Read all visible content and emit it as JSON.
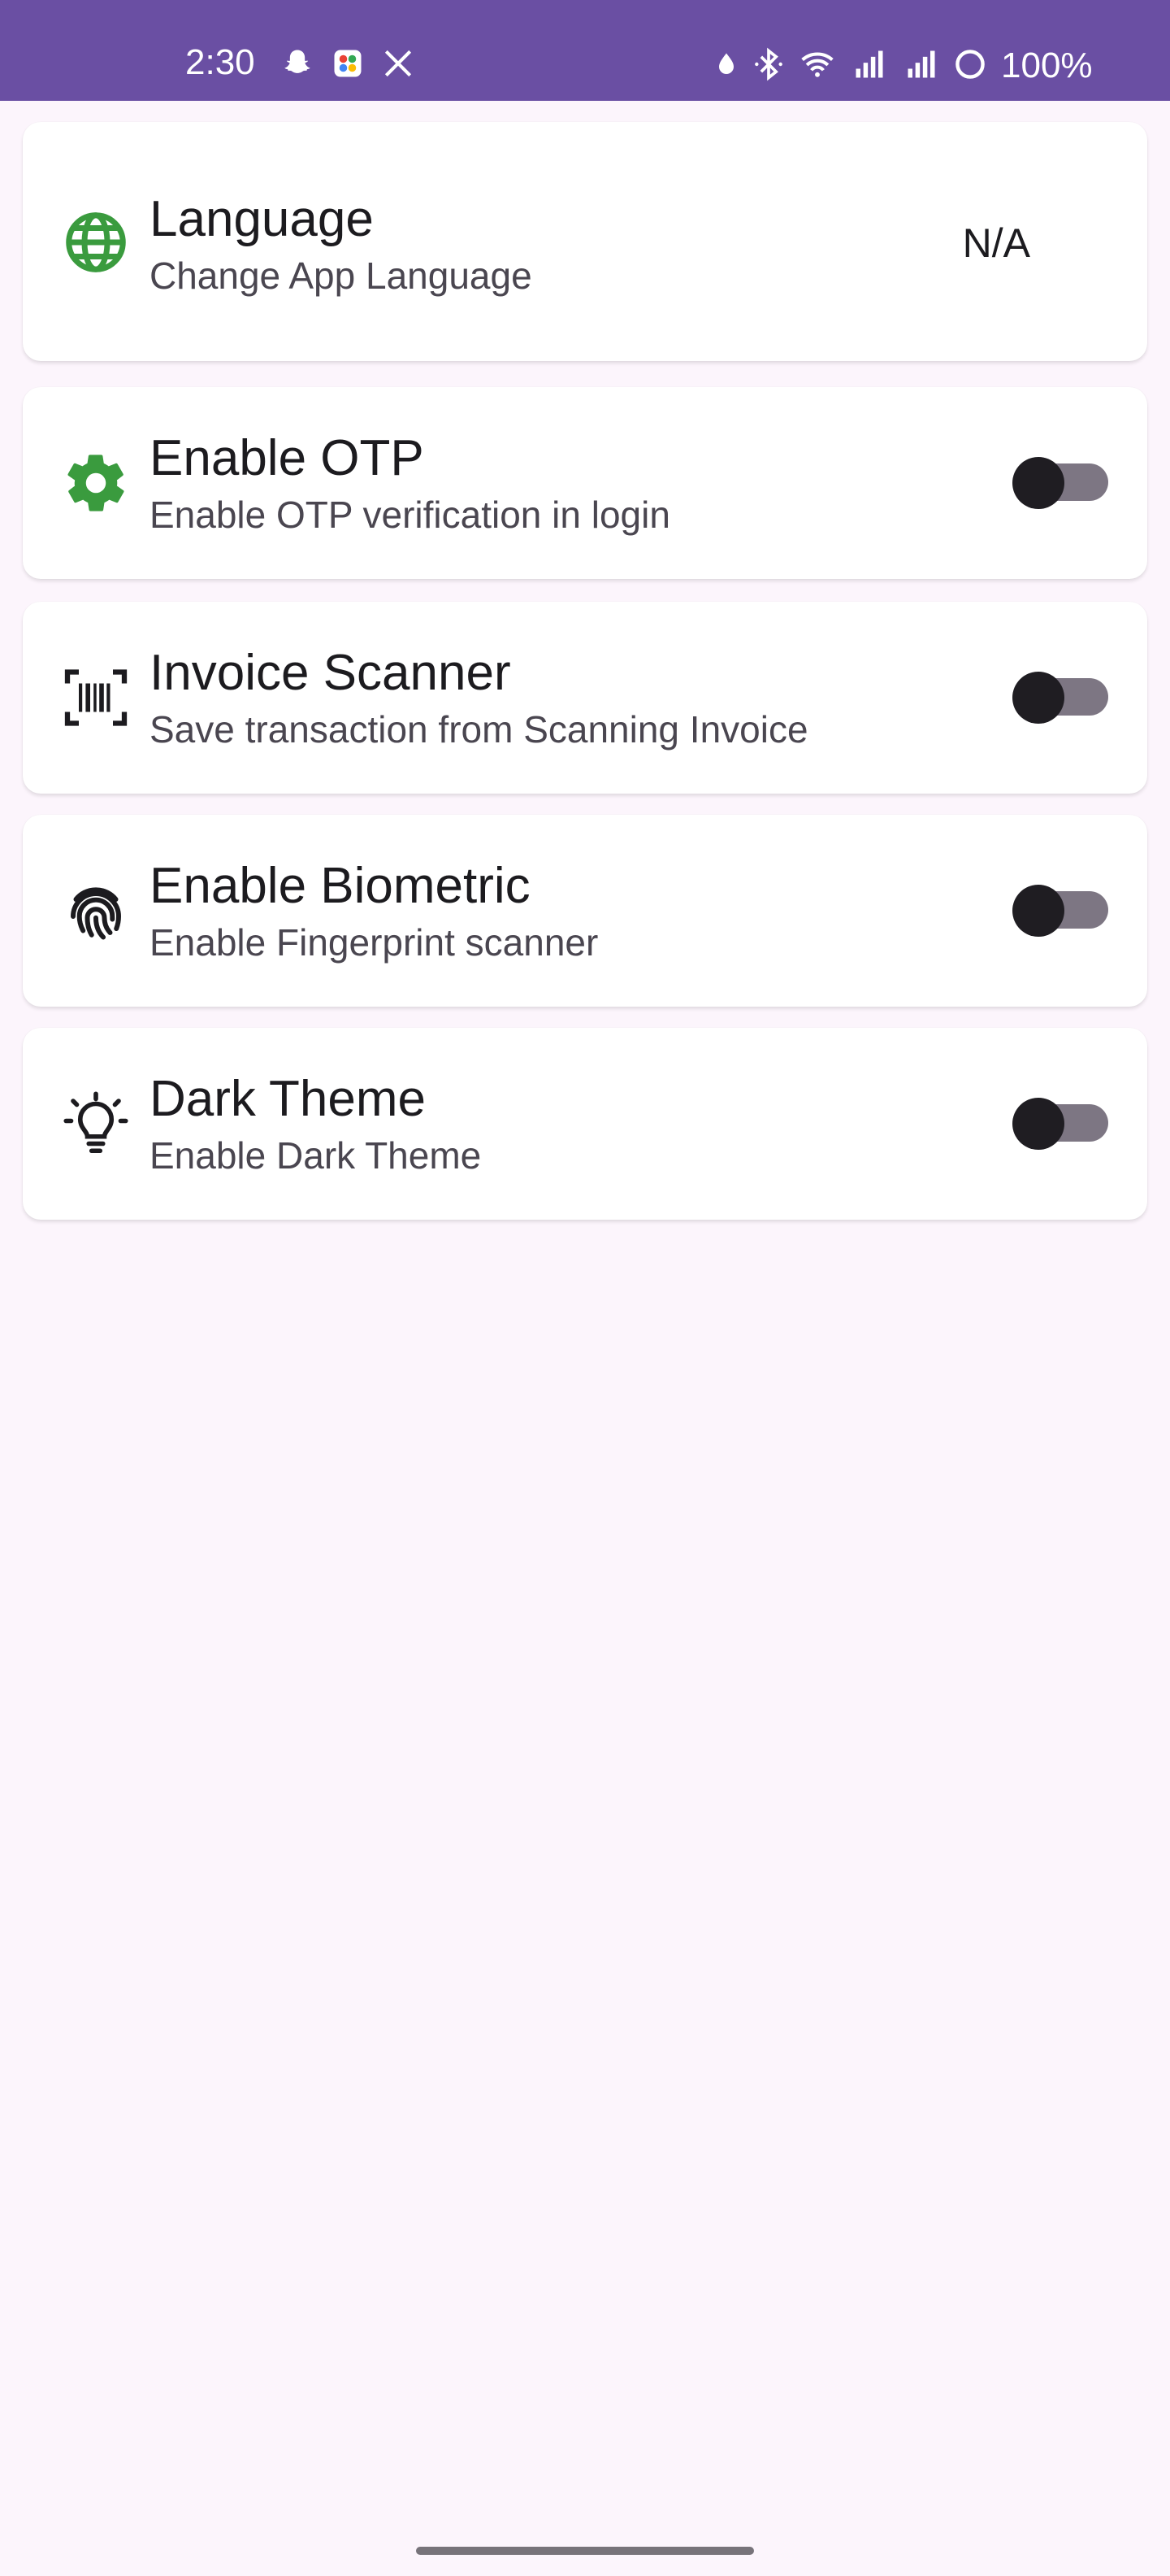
{
  "status_bar": {
    "time": "2:30",
    "battery": "100%",
    "notification_icons": [
      "snapchat-icon",
      "photos-app-icon",
      "x-icon"
    ],
    "system_icons": [
      "data-saver-icon",
      "bluetooth-icon",
      "wifi-icon",
      "signal-icon",
      "signal-icon",
      "battery-icon"
    ],
    "background": "#6a4fa3"
  },
  "settings": {
    "language": {
      "title": "Language",
      "subtitle": "Change App Language",
      "value": "N/A",
      "icon": "globe-icon",
      "icon_color": "#3a9b3e"
    },
    "otp": {
      "title": "Enable OTP",
      "subtitle": "Enable OTP verification in login",
      "enabled": false,
      "icon": "gear-icon",
      "icon_color": "#3a9b3e"
    },
    "invoice_scanner": {
      "title": "Invoice Scanner",
      "subtitle": "Save transaction from Scanning Invoice",
      "enabled": false,
      "icon": "barcode-scanner-icon"
    },
    "biometric": {
      "title": "Enable Biometric",
      "subtitle": "Enable Fingerprint scanner",
      "enabled": false,
      "icon": "fingerprint-icon"
    },
    "dark_theme": {
      "title": "Dark Theme",
      "subtitle": "Enable Dark Theme",
      "enabled": false,
      "icon": "lightbulb-icon"
    }
  }
}
